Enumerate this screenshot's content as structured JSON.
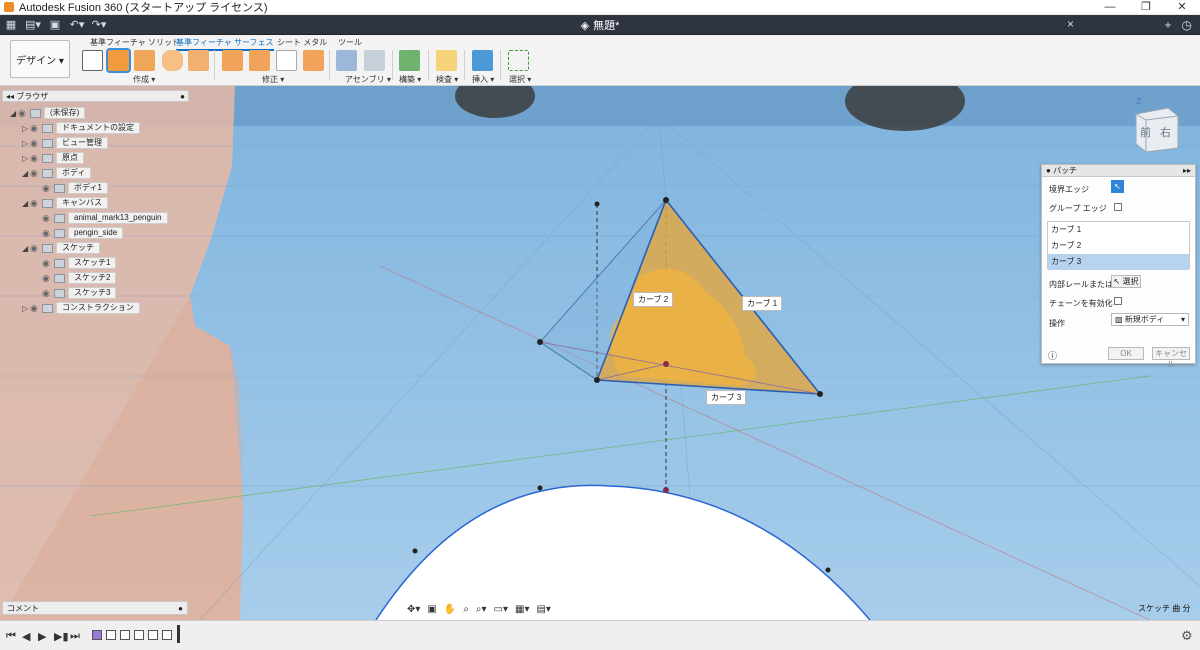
{
  "window": {
    "title": "Autodesk Fusion 360 (スタートアップ ライセンス)",
    "minimize": "—",
    "restore": "❐",
    "close": "✕"
  },
  "quickbar": {
    "doc_title": "無題*",
    "tab_close": "×",
    "new_tab": "+"
  },
  "ribbon": {
    "workspace": "デザイン ▾",
    "tabs": [
      "基準フィーチャ ソリッド",
      "基準フィーチャ サーフェス",
      "シート メタル",
      "ツール"
    ],
    "active_tab": 1,
    "groups": [
      "作成 ▾",
      "修正 ▾",
      "アセンブリ ▾",
      "構築 ▾",
      "検査 ▾",
      "挿入 ▾",
      "選択 ▾"
    ]
  },
  "browser": {
    "title": "ブラウザ",
    "rows": [
      {
        "label": "(未保存)",
        "indent": 0
      },
      {
        "label": "ドキュメントの設定",
        "indent": 1
      },
      {
        "label": "ビュー管理",
        "indent": 1
      },
      {
        "label": "原点",
        "indent": 1
      },
      {
        "label": "ボディ",
        "indent": 1
      },
      {
        "label": "ボディ1",
        "indent": 2
      },
      {
        "label": "キャンバス",
        "indent": 1
      },
      {
        "label": "animal_mark13_penguin",
        "indent": 2
      },
      {
        "label": "pengin_side",
        "indent": 2
      },
      {
        "label": "スケッチ",
        "indent": 1
      },
      {
        "label": "スケッチ1",
        "indent": 2
      },
      {
        "label": "スケッチ2",
        "indent": 2
      },
      {
        "label": "スケッチ3",
        "indent": 2
      },
      {
        "label": "コンストラクション",
        "indent": 1
      }
    ]
  },
  "patch": {
    "title": "パッチ",
    "boundary_edge": "境界エッジ",
    "group_edge": "グループ エッジ",
    "curves": [
      "カーブ 1",
      "カーブ 2",
      "カーブ 3"
    ],
    "selected_curve": 2,
    "inner_rail": "内部レールまたは点",
    "select_btn": "選択",
    "chain": "チェーンを有効化",
    "operation": "操作",
    "operation_value": "新規ボディ",
    "ok": "OK",
    "cancel": "キャンセル"
  },
  "canvas": {
    "labels": [
      "カーブ 2",
      "カーブ 1",
      "カーブ 3"
    ],
    "viewcube": [
      "前",
      "右"
    ]
  },
  "comment": "コメント",
  "status": "スケッチ 曲 分"
}
